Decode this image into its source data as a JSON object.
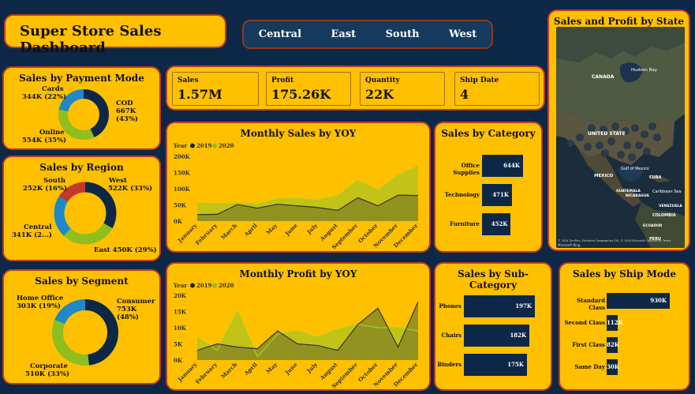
{
  "header": {
    "title": "Super Store Sales Dashboard"
  },
  "regions": [
    "Central",
    "East",
    "South",
    "West"
  ],
  "kpis": [
    {
      "label": "Sales",
      "value": "1.57M"
    },
    {
      "label": "Profit",
      "value": "175.26K"
    },
    {
      "label": "Quantity",
      "value": "22K"
    },
    {
      "label": "Ship Date",
      "value": "4"
    }
  ],
  "payment": {
    "title": "Sales by Payment Mode",
    "cards": "Cards",
    "cards_val": "344K (22%)",
    "cod": "COD",
    "cod_val": "667K (43%)",
    "online": "Online",
    "online_val": "554K (35%)"
  },
  "region": {
    "title": "Sales by Region",
    "south": "South",
    "south_val": "252K (16%)",
    "west": "West",
    "west_val": "522K (33%)",
    "central": "Central",
    "central_val": "341K (2...)",
    "east": "East 450K (29%)"
  },
  "segment": {
    "title": "Sales by Segment",
    "home": "Home Office",
    "home_val": "303K (19%)",
    "consumer": "Consumer",
    "consumer_val": "753K (48%)",
    "corporate": "Corporate",
    "corporate_val": "510K (33%)"
  },
  "monthly_sales": {
    "title": "Monthly Sales by YOY",
    "legend_label": "Year",
    "years": [
      "2019",
      "2020"
    ],
    "yticks": [
      "200K",
      "150K",
      "100K",
      "50K",
      "0K"
    ],
    "months": [
      "January",
      "February",
      "March",
      "April",
      "May",
      "June",
      "July",
      "August",
      "September",
      "October",
      "November",
      "December"
    ],
    "s2019": [
      20,
      21,
      51,
      40,
      52,
      47,
      42,
      33,
      72,
      47,
      80,
      79
    ],
    "s2020": [
      55,
      54,
      56,
      52,
      68,
      69,
      64,
      78,
      125,
      95,
      141,
      170
    ]
  },
  "monthly_profit": {
    "title": "Monthly Profit by YOY",
    "legend_label": "Year",
    "years": [
      "2019",
      "2020"
    ],
    "yticks": [
      "20K",
      "15K",
      "10K",
      "5K",
      "0K"
    ],
    "profit2019": [
      3,
      5,
      4,
      3.5,
      9,
      5,
      4.5,
      3,
      11,
      16,
      4,
      18
    ],
    "profit2020": [
      7,
      3,
      15,
      1,
      8,
      9,
      7,
      9.5,
      11,
      10,
      10,
      9
    ]
  },
  "chart_data": [
    {
      "type": "area",
      "title": "Monthly Sales by YOY",
      "categories": [
        "January",
        "February",
        "March",
        "April",
        "May",
        "June",
        "July",
        "August",
        "September",
        "October",
        "November",
        "December"
      ],
      "series": [
        {
          "name": "2019",
          "values": [
            20,
            21,
            51,
            40,
            52,
            47,
            42,
            33,
            72,
            47,
            80,
            79
          ]
        },
        {
          "name": "2020",
          "values": [
            55,
            54,
            56,
            52,
            68,
            69,
            64,
            78,
            125,
            95,
            141,
            170
          ]
        }
      ],
      "ylim": [
        0,
        200
      ]
    },
    {
      "type": "area",
      "title": "Monthly Profit by YOY",
      "categories": [
        "January",
        "February",
        "March",
        "April",
        "May",
        "June",
        "July",
        "August",
        "September",
        "October",
        "November",
        "December"
      ],
      "series": [
        {
          "name": "2019",
          "values": [
            3,
            5,
            4,
            3.5,
            9,
            5,
            4.5,
            3,
            11,
            16,
            4,
            18
          ]
        },
        {
          "name": "2020",
          "values": [
            7,
            3,
            15,
            1,
            8,
            9,
            7,
            9.5,
            11,
            10,
            10,
            9
          ]
        }
      ],
      "ylim": [
        0,
        20
      ]
    },
    {
      "type": "bar",
      "title": "Sales by Category",
      "categories": [
        "Office Supplies",
        "Technology",
        "Furniture"
      ],
      "values": [
        644,
        471,
        452
      ],
      "labels": [
        "644K",
        "471K",
        "452K"
      ]
    },
    {
      "type": "bar",
      "title": "Sales by Sub-Category",
      "categories": [
        "Phones",
        "Chairs",
        "Binders"
      ],
      "values": [
        197,
        182,
        175
      ],
      "labels": [
        "197K",
        "182K",
        "175K"
      ]
    },
    {
      "type": "bar",
      "title": "Sales by Ship Mode",
      "categories": [
        "Standard Class",
        "Second Class",
        "First Class",
        "Same Day"
      ],
      "values": [
        930,
        112,
        82,
        30
      ],
      "labels": [
        "930K",
        "112K",
        "82K",
        "30K"
      ]
    }
  ],
  "category": {
    "title": "Sales by Category",
    "items": [
      {
        "label": "Office Supplies",
        "value": "644K",
        "v": 644
      },
      {
        "label": "Technology",
        "value": "471K",
        "v": 471
      },
      {
        "label": "Furniture",
        "value": "452K",
        "v": 452
      }
    ]
  },
  "subcategory": {
    "title": "Sales by Sub-Category",
    "items": [
      {
        "label": "Phones",
        "value": "197K",
        "v": 197
      },
      {
        "label": "Chairs",
        "value": "182K",
        "v": 182
      },
      {
        "label": "Binders",
        "value": "175K",
        "v": 175
      }
    ]
  },
  "shipmode": {
    "title": "Sales by Ship Mode",
    "items": [
      {
        "label": "Standard Class",
        "value": "930K",
        "v": 930
      },
      {
        "label": "Second Class",
        "value": "112K",
        "v": 112
      },
      {
        "label": "First Class",
        "value": "82K",
        "v": 82
      },
      {
        "label": "Same Day",
        "value": "30K",
        "v": 30
      }
    ]
  },
  "map": {
    "title": "Sales and Profit by State",
    "labels": {
      "hudson": "Hudson Bay",
      "canada": "CANADA",
      "us": "UNITED STATE",
      "mexico": "MEXICO",
      "gulf": "Gulf of Mexico",
      "cuba": "CUBA",
      "guatemala": "GUATEMALA",
      "nicaragua": "NICARAGUA",
      "caribbean": "Caribbean Sea",
      "venezuela": "VENEZUELA",
      "colombia": "COLOMBIA",
      "ecuador": "ECUADOR",
      "peru": "PERU"
    },
    "copyright": "© 2024 TomTom, Earthstar Geographics SIO, © 2024 Microsoft Corporation Terms",
    "bing": "Microsoft Bing"
  },
  "colors": {
    "dark": "#0d2847",
    "gold": "#ffc000",
    "green": "#8fbf1f",
    "blue": "#1e88c8",
    "red": "#c0392b",
    "olive": "#8f8f1f"
  }
}
